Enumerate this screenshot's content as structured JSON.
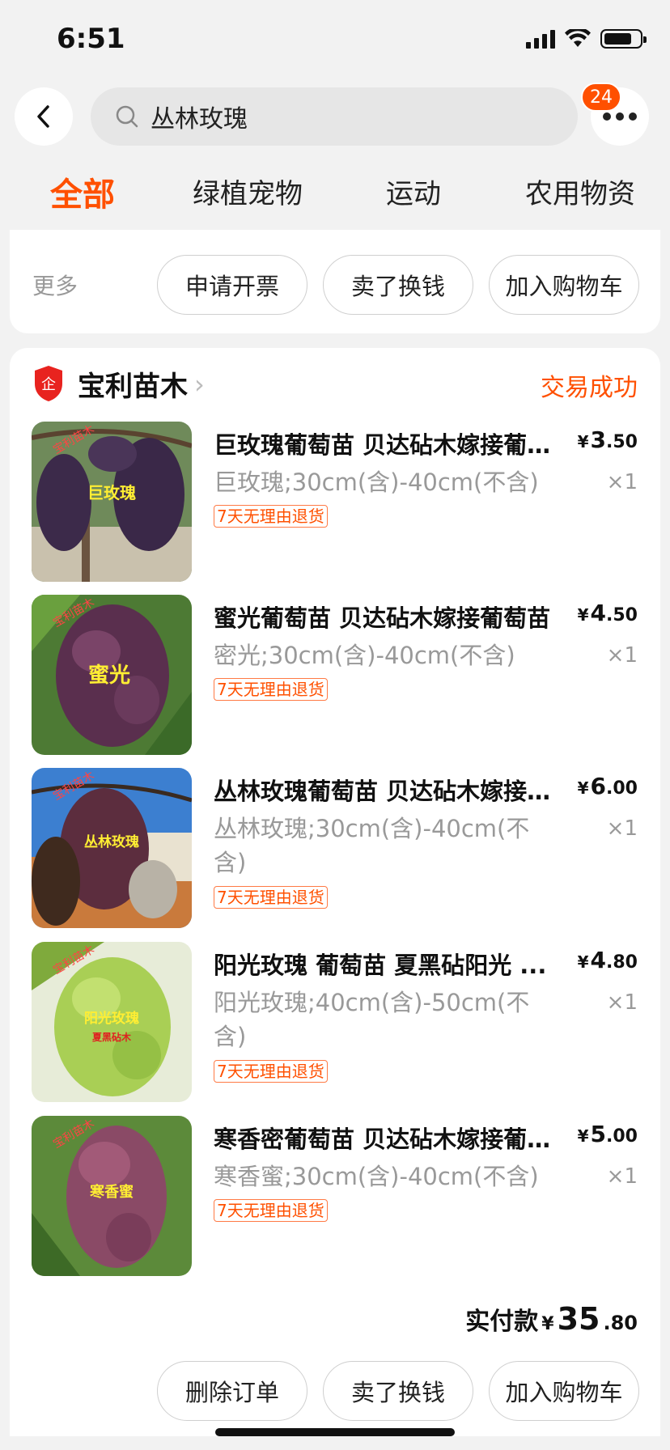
{
  "status_bar": {
    "time": "6:51"
  },
  "search": {
    "query": "丛林玫瑰"
  },
  "more_badge": "24",
  "tabs": [
    {
      "label": "全部"
    },
    {
      "label": "绿植宠物"
    },
    {
      "label": "运动"
    },
    {
      "label": "农用物资"
    }
  ],
  "prev_card": {
    "more_label": "更多",
    "buttons": [
      "申请开票",
      "卖了换钱",
      "加入购物车"
    ]
  },
  "order": {
    "shop_name": "宝利苗木",
    "shop_badge": "企",
    "status": "交易成功",
    "items": [
      {
        "title": "巨玫瑰葡萄苗 贝达砧木嫁接葡萄苗",
        "spec": "巨玫瑰;30cm(含)-40cm(不含)",
        "tag": "7天无理由退货",
        "price_currency": "¥",
        "price_int": "3",
        "price_dec": ".50",
        "qty": "×1",
        "img_label": "巨玫瑰",
        "img_watermark": "宝利苗木"
      },
      {
        "title": "蜜光葡萄苗 贝达砧木嫁接葡萄苗",
        "spec": "密光;30cm(含)-40cm(不含)",
        "tag": "7天无理由退货",
        "price_currency": "¥",
        "price_int": "4",
        "price_dec": ".50",
        "qty": "×1",
        "img_label": "蜜光",
        "img_watermark": "宝利苗木"
      },
      {
        "title": "丛林玫瑰葡萄苗 贝达砧木嫁接葡萄苗",
        "spec": "丛林玫瑰;30cm(含)-40cm(不含)",
        "tag": "7天无理由退货",
        "price_currency": "¥",
        "price_int": "6",
        "price_dec": ".00",
        "qty": "×1",
        "img_label": "丛林玫瑰",
        "img_watermark": "宝利苗木"
      },
      {
        "title": "阳光玫瑰 葡萄苗 夏黑砧阳光 ...",
        "spec": "阳光玫瑰;40cm(含)-50cm(不含)",
        "tag": "7天无理由退货",
        "price_currency": "¥",
        "price_int": "4",
        "price_dec": ".80",
        "qty": "×1",
        "img_label": "阳光玫瑰",
        "img_sublabel": "夏黑砧木",
        "img_watermark": "宝利苗木"
      },
      {
        "title": "寒香密葡萄苗  贝达砧木嫁接葡萄苗",
        "spec": "寒香蜜;30cm(含)-40cm(不含)",
        "tag": "7天无理由退货",
        "price_currency": "¥",
        "price_int": "5",
        "price_dec": ".00",
        "qty": "×1",
        "img_label": "寒香蜜",
        "img_watermark": "宝利苗木"
      }
    ],
    "total_label": "实付款",
    "total_currency": "¥",
    "total_int": "35",
    "total_dec": ".80",
    "buttons": [
      "删除订单",
      "卖了换钱",
      "加入购物车"
    ]
  },
  "colors": {
    "accent": "#ff5000",
    "muted": "#999999",
    "background": "#f2f2f2"
  }
}
